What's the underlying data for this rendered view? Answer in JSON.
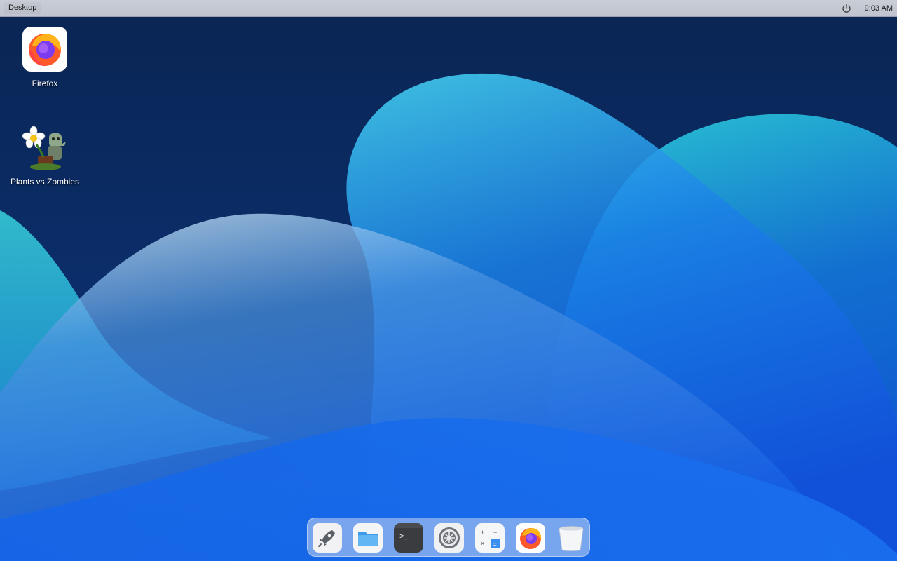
{
  "topbar": {
    "title": "Desktop",
    "clock": "9:03 AM",
    "power_icon": "power-icon"
  },
  "desktop_icons": [
    {
      "label": "Firefox",
      "icon": "firefox-icon"
    },
    {
      "label": "Plants vs Zombies",
      "icon": "plants-vs-zombies-icon"
    }
  ],
  "dock": {
    "items": [
      {
        "icon": "launchpad-rocket-icon"
      },
      {
        "icon": "files-folder-icon"
      },
      {
        "icon": "terminal-icon"
      },
      {
        "icon": "settings-gear-icon"
      },
      {
        "icon": "calculator-icon"
      },
      {
        "icon": "firefox-icon"
      },
      {
        "icon": "trash-icon"
      }
    ]
  },
  "colors": {
    "wallpaper_dark": "#0a2553",
    "wallpaper_cyan": "#3fd6e0",
    "wallpaper_blue": "#1665e6",
    "topbar": "#c5c9d2"
  }
}
